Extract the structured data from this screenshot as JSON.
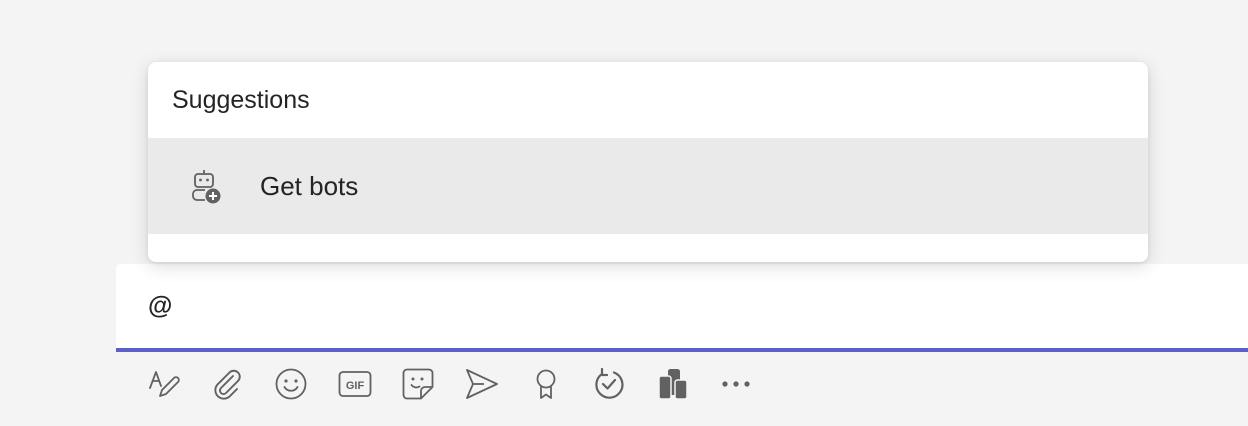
{
  "suggestions": {
    "header": "Suggestions",
    "items": [
      {
        "label": "Get bots",
        "icon": "bot-add-icon"
      }
    ]
  },
  "compose": {
    "text": "@"
  },
  "toolbar": {
    "tools": [
      {
        "icon": "format-text-icon"
      },
      {
        "icon": "attach-icon"
      },
      {
        "icon": "emoji-icon"
      },
      {
        "icon": "gif-icon",
        "text": "GIF"
      },
      {
        "icon": "sticker-icon"
      },
      {
        "icon": "meet-now-icon"
      },
      {
        "icon": "praise-icon"
      },
      {
        "icon": "loop-icon"
      },
      {
        "icon": "apps-icon"
      },
      {
        "icon": "more-options-icon"
      }
    ]
  },
  "colors": {
    "accent": "#5b5fc7",
    "icon": "#616161",
    "hover": "#ebeaea"
  }
}
